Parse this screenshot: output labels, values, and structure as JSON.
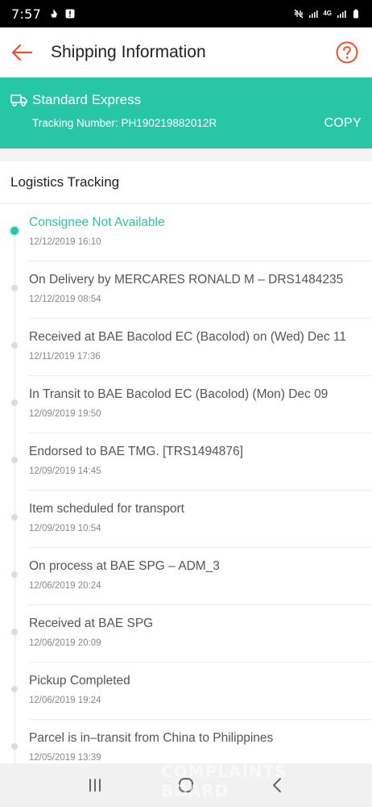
{
  "status_bar": {
    "time": "7:57",
    "network_label": "4G",
    "left_icons": [
      "boat-notification-icon",
      "alert-notification-icon"
    ],
    "right_icons": [
      "vibrate-mute-icon",
      "signal-icon",
      "signal-4g-icon",
      "battery-icon"
    ]
  },
  "header": {
    "title": "Shipping Information"
  },
  "shipping": {
    "service": "Standard Express",
    "tracking_number_label": "Tracking Number: PH190219882012R",
    "copy_label": "COPY"
  },
  "logistics": {
    "heading": "Logistics Tracking",
    "events": [
      {
        "title": "Consignee Not Available",
        "time": "12/12/2019 16:10",
        "active": true
      },
      {
        "title": "On Delivery by MERCARES RONALD M – DRS1484235",
        "time": "12/12/2019 08:54"
      },
      {
        "title": "Received at BAE Bacolod EC (Bacolod) on (Wed) Dec 11",
        "time": "12/11/2019 17:36"
      },
      {
        "title": "In Transit to BAE Bacolod EC (Bacolod) (Mon) Dec 09",
        "time": "12/09/2019 19:50"
      },
      {
        "title": "Endorsed to BAE TMG. [TRS1494876]",
        "time": "12/09/2019 14:45"
      },
      {
        "title": "Item scheduled for transport",
        "time": "12/09/2019 10:54"
      },
      {
        "title": "On process at BAE SPG – ADM_3",
        "time": "12/06/2019 20:24"
      },
      {
        "title": "Received at BAE SPG",
        "time": "12/06/2019 20:09"
      },
      {
        "title": "Pickup Completed",
        "time": "12/06/2019 19:24"
      },
      {
        "title": "Parcel is in–transit from China to Philippines",
        "time": "12/05/2019 13:39"
      }
    ]
  },
  "colors": {
    "accent": "#26c6a6",
    "back_arrow": "#ee4d2d",
    "help": "#ee4d2d"
  },
  "watermark_text": "COMPLAINTS BOARD"
}
